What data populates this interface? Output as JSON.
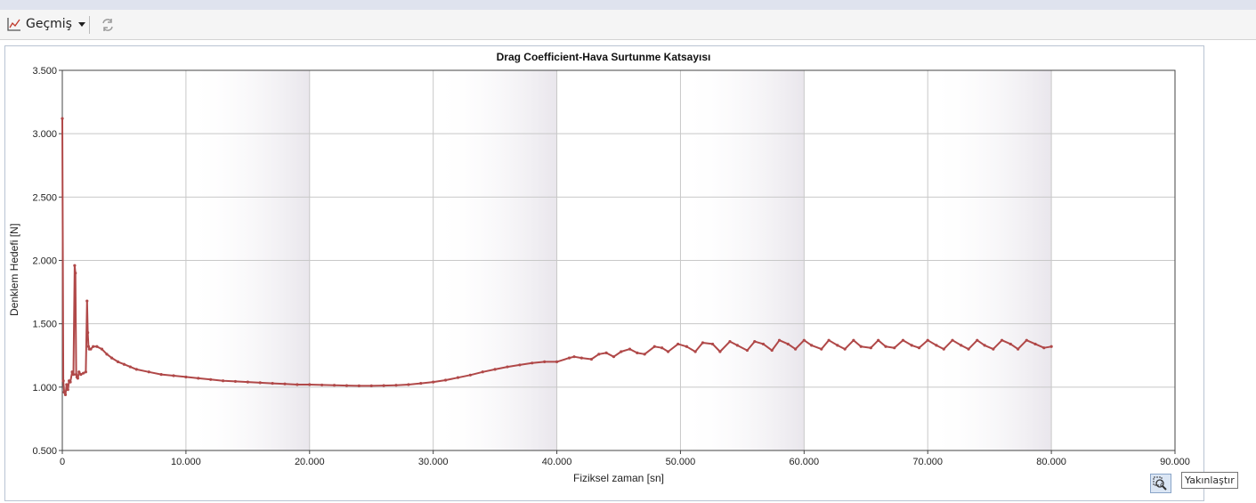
{
  "toolbar": {
    "history_label": "Geçmiş",
    "history_icon": "line-chart-icon",
    "refresh_icon": "refresh-icon"
  },
  "zoom": {
    "tooltip": "Yakınlaştır",
    "icon": "zoom-icon"
  },
  "colors": {
    "series": "#b04848",
    "band": "#ece9ef",
    "grid": "#c8c8c8"
  },
  "chart_data": {
    "type": "line",
    "title": "Drag Coefficient-Hava Surtunme Katsayısı",
    "xlabel": "Fiziksel zaman [sn]",
    "ylabel": "Denklem Hedefi [N]",
    "xlim": [
      0,
      90000
    ],
    "ylim": [
      0.5,
      3.5
    ],
    "xticks": [
      0,
      10000,
      20000,
      30000,
      40000,
      50000,
      60000,
      70000,
      80000,
      90000
    ],
    "xtick_labels": [
      "0",
      "10.000",
      "20.000",
      "30.000",
      "40.000",
      "50.000",
      "60.000",
      "70.000",
      "80.000",
      "90.000"
    ],
    "yticks": [
      0.5,
      1.0,
      1.5,
      2.0,
      2.5,
      3.0,
      3.5
    ],
    "ytick_labels": [
      "0.500",
      "1.000",
      "1.500",
      "2.000",
      "2.500",
      "3.000",
      "3.500"
    ],
    "grid": true,
    "legend": "none",
    "series": [
      {
        "color": "#b04848",
        "x": [
          0,
          80,
          150,
          250,
          350,
          450,
          550,
          650,
          800,
          900,
          1000,
          1060,
          1120,
          1180,
          1250,
          1350,
          1500,
          1700,
          1900,
          2000,
          2060,
          2120,
          2180,
          2300,
          2500,
          2800,
          3200,
          3600,
          4000,
          4500,
          5000,
          5500,
          6000,
          7000,
          8000,
          9000,
          10000,
          11000,
          12000,
          13000,
          14000,
          15000,
          16000,
          17000,
          18000,
          19000,
          20000,
          21000,
          22000,
          23000,
          24000,
          25000,
          26000,
          27000,
          28000,
          29000,
          30000,
          31000,
          32000,
          33000,
          34000,
          35000,
          36000,
          37000,
          38000,
          39000,
          40000,
          41000,
          41400,
          42000,
          42800,
          43400,
          44000,
          44600,
          45200,
          45900,
          46500,
          47100,
          47900,
          48500,
          49000,
          49800,
          50500,
          51200,
          51800,
          52600,
          53200,
          54000,
          54600,
          55400,
          56000,
          56700,
          57400,
          58000,
          58700,
          59300,
          60000,
          60600,
          61400,
          62000,
          62700,
          63300,
          64000,
          64600,
          65400,
          66000,
          66600,
          67300,
          68000,
          68700,
          69300,
          70000,
          70700,
          71300,
          72000,
          72700,
          73300,
          74000,
          74600,
          75300,
          76000,
          76700,
          77300,
          78000,
          78700,
          79400,
          80000
        ],
        "y": [
          3.12,
          1.05,
          0.96,
          0.94,
          1.02,
          0.98,
          1.05,
          1.04,
          1.12,
          1.1,
          1.96,
          1.9,
          1.1,
          1.08,
          1.07,
          1.12,
          1.1,
          1.11,
          1.12,
          1.68,
          1.43,
          1.32,
          1.3,
          1.3,
          1.32,
          1.32,
          1.3,
          1.26,
          1.23,
          1.2,
          1.18,
          1.16,
          1.14,
          1.12,
          1.1,
          1.09,
          1.08,
          1.07,
          1.06,
          1.05,
          1.045,
          1.04,
          1.035,
          1.03,
          1.025,
          1.02,
          1.02,
          1.017,
          1.015,
          1.012,
          1.01,
          1.01,
          1.012,
          1.015,
          1.02,
          1.03,
          1.04,
          1.055,
          1.075,
          1.095,
          1.12,
          1.14,
          1.16,
          1.175,
          1.19,
          1.2,
          1.2,
          1.23,
          1.24,
          1.23,
          1.22,
          1.26,
          1.27,
          1.24,
          1.28,
          1.3,
          1.27,
          1.26,
          1.32,
          1.31,
          1.28,
          1.34,
          1.32,
          1.28,
          1.35,
          1.34,
          1.28,
          1.36,
          1.33,
          1.29,
          1.36,
          1.34,
          1.29,
          1.37,
          1.34,
          1.3,
          1.37,
          1.33,
          1.3,
          1.37,
          1.33,
          1.3,
          1.37,
          1.32,
          1.31,
          1.37,
          1.32,
          1.31,
          1.37,
          1.33,
          1.31,
          1.37,
          1.33,
          1.3,
          1.37,
          1.33,
          1.3,
          1.37,
          1.33,
          1.3,
          1.37,
          1.34,
          1.3,
          1.37,
          1.34,
          1.31,
          1.32
        ]
      }
    ]
  }
}
